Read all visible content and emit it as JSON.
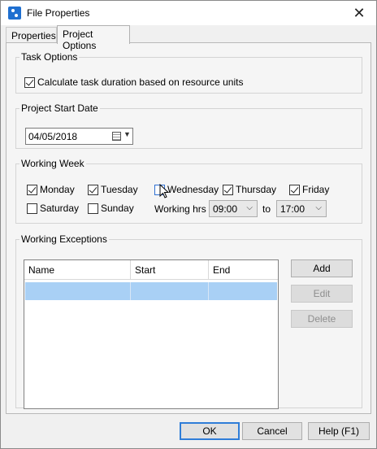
{
  "window": {
    "title": "File Properties",
    "close_glyph": "✕"
  },
  "tabs": [
    {
      "label": "Properties",
      "active": false
    },
    {
      "label": "Project Options",
      "active": true
    }
  ],
  "task_options": {
    "legend": "Task Options",
    "calc_duration": {
      "label": "Calculate task duration based on resource units",
      "checked": true
    }
  },
  "project_start": {
    "legend": "Project Start Date",
    "date_value": "04/05/2018",
    "icon": "calendar-icon"
  },
  "working_week": {
    "legend": "Working Week",
    "days": [
      {
        "label": "Monday",
        "checked": true
      },
      {
        "label": "Tuesday",
        "checked": true
      },
      {
        "label": "Wednesday",
        "checked": false
      },
      {
        "label": "Thursday",
        "checked": true
      },
      {
        "label": "Friday",
        "checked": true
      },
      {
        "label": "Saturday",
        "checked": false
      },
      {
        "label": "Sunday",
        "checked": false
      }
    ],
    "working_hrs_label": "Working hrs",
    "start_time": "09:00",
    "to_label": "to",
    "end_time": "17:00"
  },
  "working_exceptions": {
    "legend": "Working Exceptions",
    "columns": [
      "Name",
      "Start",
      "End"
    ],
    "rows": [
      [
        "",
        "",
        ""
      ]
    ],
    "add_label": "Add",
    "edit_label": "Edit",
    "delete_label": "Delete"
  },
  "footer": {
    "ok_label": "OK",
    "cancel_label": "Cancel",
    "help_label": "Help (F1)"
  },
  "colors": {
    "selection_row": "#a9d0f5",
    "default_button_border": "#2f7dd8"
  }
}
